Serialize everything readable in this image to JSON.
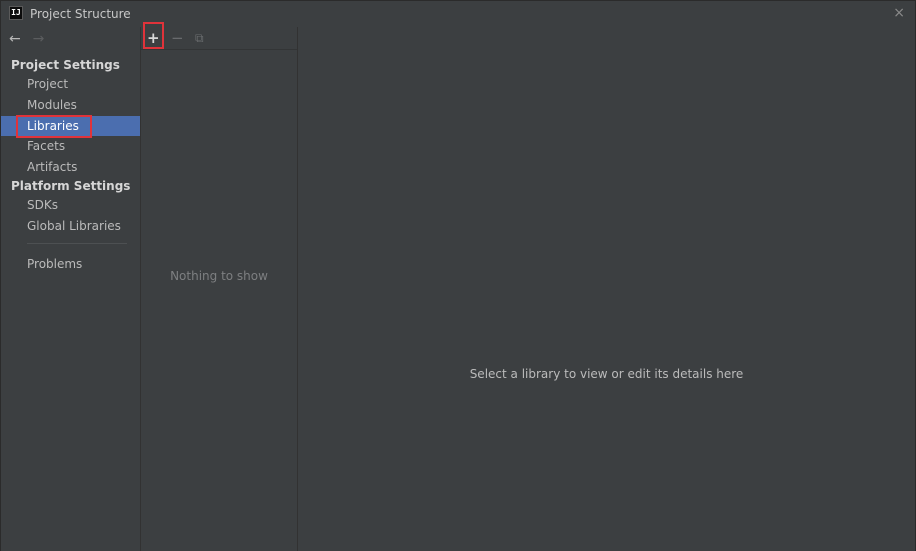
{
  "window": {
    "title": "Project Structure",
    "app_icon_text": "IJ",
    "close_glyph": "×"
  },
  "sidebar": {
    "back_glyph": "←",
    "forward_glyph": "→",
    "project_settings_header": "Project Settings",
    "project_settings_items": [
      {
        "label": "Project"
      },
      {
        "label": "Modules"
      },
      {
        "label": "Libraries",
        "selected": true
      },
      {
        "label": "Facets"
      },
      {
        "label": "Artifacts"
      }
    ],
    "platform_settings_header": "Platform Settings",
    "platform_settings_items": [
      {
        "label": "SDKs"
      },
      {
        "label": "Global Libraries"
      }
    ],
    "problems_label": "Problems"
  },
  "library_list": {
    "add_glyph": "+",
    "remove_glyph": "−",
    "copy_glyph": "⧉",
    "empty_text": "Nothing to show"
  },
  "details": {
    "placeholder_text": "Select a library to view or edit its details here"
  },
  "colors": {
    "background": "#3c3f41",
    "selection": "#4b6eaf",
    "highlight_border": "#e0333a"
  }
}
